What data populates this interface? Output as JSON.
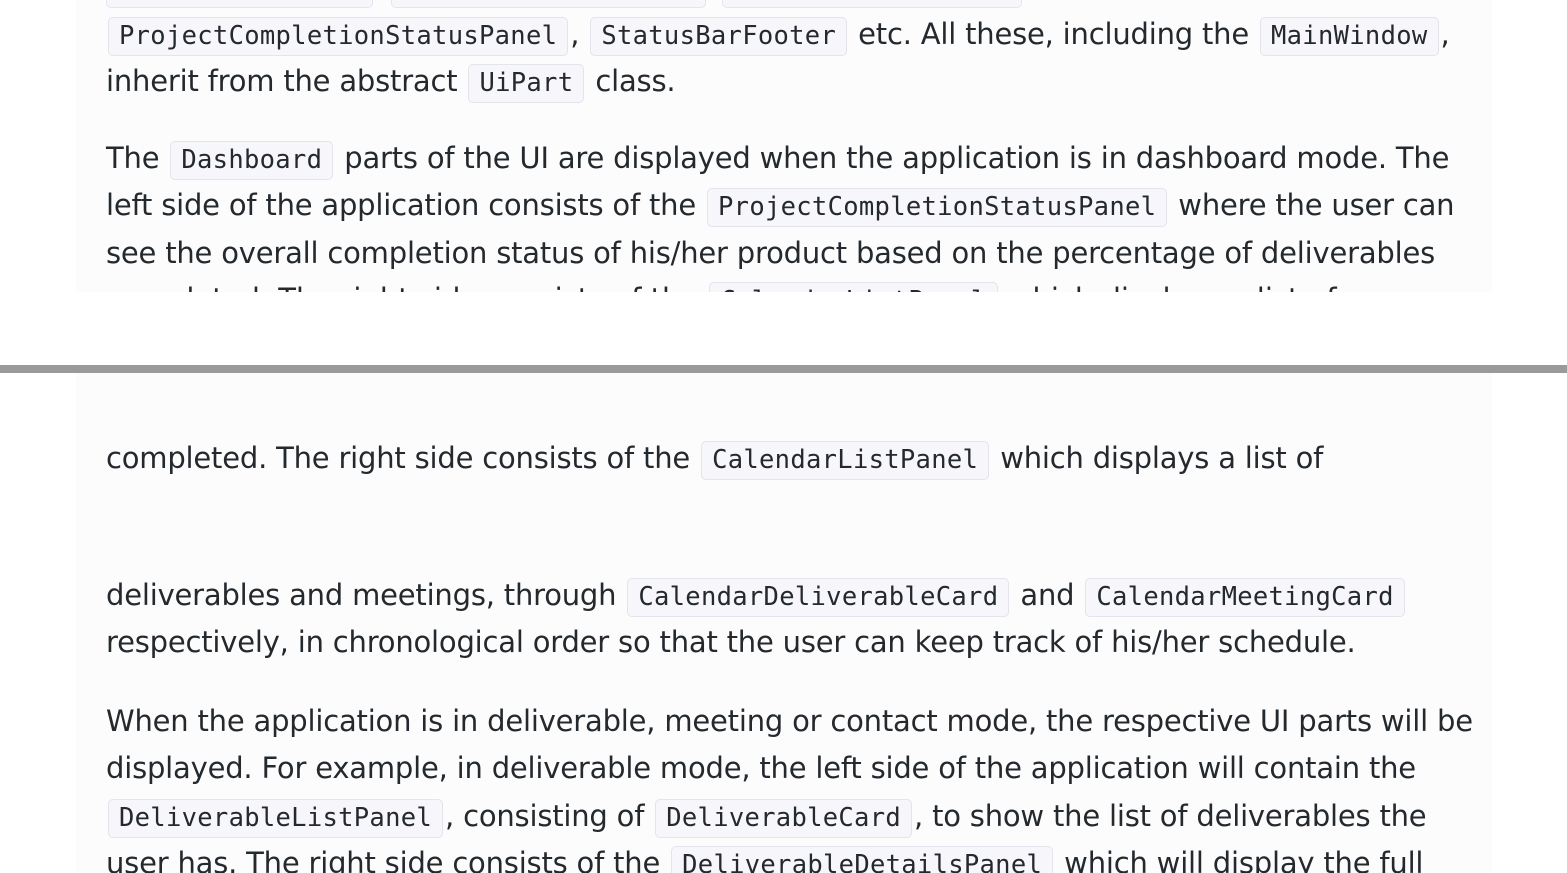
{
  "top": {
    "p1": {
      "l1_code1": "ProjectCompletionStatusPanel",
      "l1_t1": ",",
      "l1_code2": "StatusBarFooter",
      "l1_t2": " etc. All these, including the ",
      "l1_code3": "MainWindow",
      "l1_t3": ",",
      "l2_t1": "inherit from the abstract ",
      "l2_code1": "UiPart",
      "l2_t2": " class."
    },
    "p2": {
      "l1_t1": "The ",
      "l1_code1": "Dashboard",
      "l1_t2": " parts of the UI are displayed when the application is in dashboard mode. The",
      "l2_t1": "left side of the application consists of the ",
      "l2_code1": "ProjectCompletionStatusPanel",
      "l2_t2": " where the user can",
      "l3_t1": "see the overall completion status of his/her product based on the percentage of deliverables",
      "l4_t1": "completed. The right side consists of the ",
      "l4_code1": "CalendarListPanel",
      "l4_t2": " which displays a list of"
    }
  },
  "bottom": {
    "p0": {
      "l1_t1": "completed. The right side consists of the ",
      "l1_code1": "CalendarListPanel",
      "l1_t2": " which displays a list of"
    },
    "p1": {
      "l1_t1": "deliverables and meetings, through ",
      "l1_code1": "CalendarDeliverableCard",
      "l1_t2": " and ",
      "l1_code2": "CalendarMeetingCard",
      "l2_t1": "respectively, in chronological order so that the user can keep track of his/her schedule."
    },
    "p2": {
      "l1_t1": "When the application is in deliverable, meeting or contact mode, the respective UI parts will be",
      "l2_t1": "displayed. For example, in deliverable mode, the left side of the application will contain the",
      "l3_code1": "DeliverableListPanel",
      "l3_t1": ", consisting of ",
      "l3_code2": "DeliverableCard",
      "l3_t2": ", to show the list of deliverables the",
      "l4_t1": "user has. The right side consists of the ",
      "l4_code1": "DeliverableDetailsPanel",
      "l4_t2": " which will display the full"
    }
  }
}
